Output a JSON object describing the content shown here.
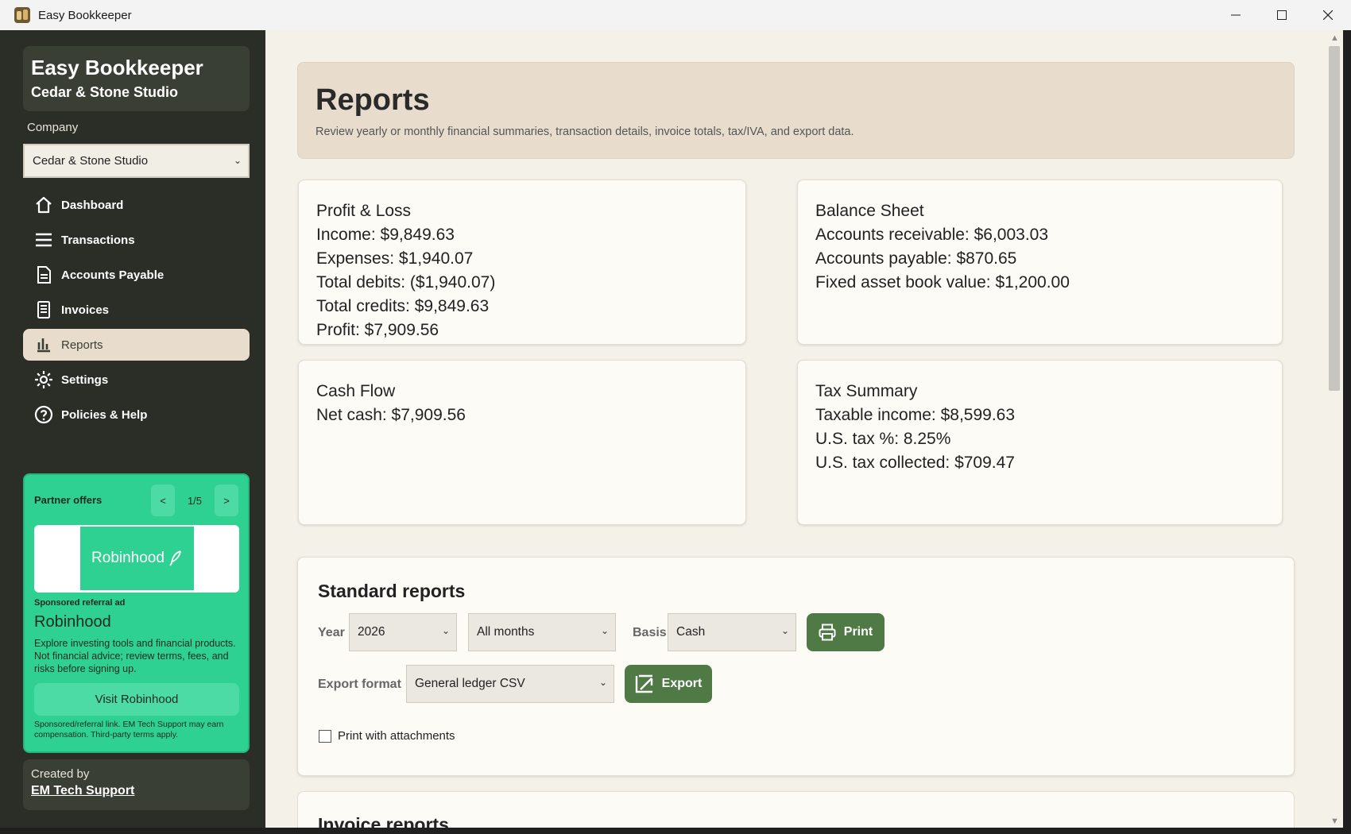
{
  "window": {
    "title": "Easy Bookkeeper",
    "minimize": "—",
    "maximize": "☐",
    "close": "✕"
  },
  "sidebar": {
    "brand_title": "Easy Bookkeeper",
    "brand_subtitle": "Cedar & Stone Studio",
    "company_label": "Company",
    "company_value": "Cedar & Stone Studio",
    "items": [
      {
        "label": "Dashboard",
        "icon": "home-icon"
      },
      {
        "label": "Transactions",
        "icon": "list-icon"
      },
      {
        "label": "Accounts Payable",
        "icon": "document-icon"
      },
      {
        "label": "Invoices",
        "icon": "receipt-icon"
      },
      {
        "label": "Reports",
        "icon": "bar-chart-icon",
        "active": true
      },
      {
        "label": "Settings",
        "icon": "gear-icon"
      },
      {
        "label": "Policies & Help",
        "icon": "help-icon"
      }
    ]
  },
  "partner": {
    "heading": "Partner offers",
    "prev": "<",
    "next": ">",
    "count": "1/5",
    "logo_text": "Robinhood",
    "tag": "Sponsored referral ad",
    "name": "Robinhood",
    "description": "Explore investing tools and financial products. Not financial advice; review terms, fees, and risks before signing up.",
    "cta": "Visit Robinhood",
    "fine_print": "Sponsored/referral link. EM Tech Support may earn compensation. Third-party terms apply."
  },
  "credit": {
    "label": "Created by",
    "link": "EM Tech Support"
  },
  "hero": {
    "title": "Reports",
    "description": "Review yearly or monthly financial summaries, transaction details, invoice totals, tax/IVA, and export data."
  },
  "cards": {
    "pl": {
      "title": "Profit & Loss",
      "income": "Income: $9,849.63",
      "expenses": "Expenses: $1,940.07",
      "debits": "Total debits: ($1,940.07)",
      "credits": "Total credits: $9,849.63",
      "profit": "Profit: $7,909.56"
    },
    "bs": {
      "title": "Balance Sheet",
      "ar": "Accounts receivable: $6,003.03",
      "ap": "Accounts payable: $870.65",
      "fixed": "Fixed asset book value: $1,200.00"
    },
    "cf": {
      "title": "Cash Flow",
      "net": "Net cash: $7,909.56"
    },
    "tax": {
      "title": "Tax Summary",
      "taxable": "Taxable income: $8,599.63",
      "rate": "U.S. tax %: 8.25%",
      "collected": "U.S. tax collected: $709.47"
    }
  },
  "standard": {
    "title": "Standard reports",
    "year_label": "Year",
    "year_value": "2026",
    "month_value": "All months",
    "basis_label": "Basis",
    "basis_value": "Cash",
    "print_label": "Print",
    "export_label": "Export format",
    "export_value": "General ledger CSV",
    "export_button": "Export",
    "attachments_label": "Print with attachments"
  },
  "invoice_reports": {
    "title": "Invoice reports"
  },
  "colors": {
    "sidebar_bg": "#2b2e27",
    "accent_green": "#4f7a45",
    "partner_bg": "#2fd193",
    "active_nav": "#e8ddcc"
  }
}
